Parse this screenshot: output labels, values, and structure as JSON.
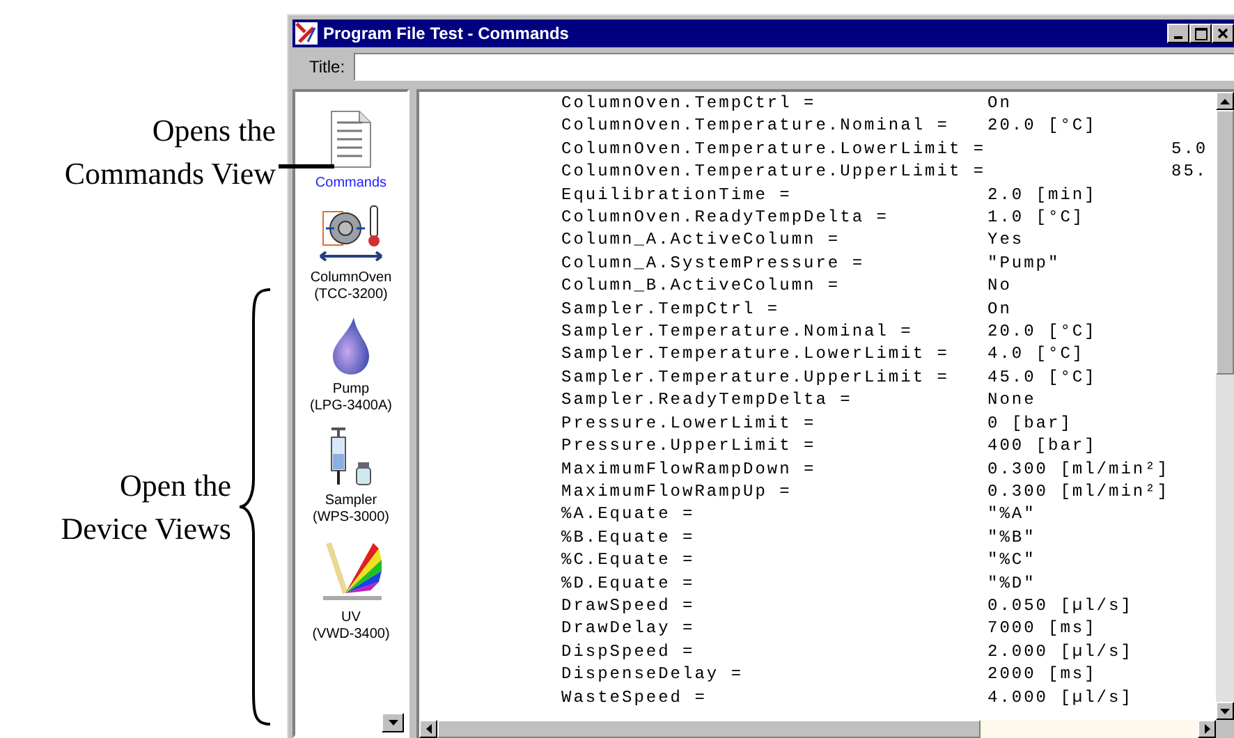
{
  "annotations": [
    {
      "kind": "leader",
      "text": "Opens the Commands View"
    },
    {
      "kind": "brace",
      "text": "Open the Device Views"
    }
  ],
  "window": {
    "title": "Program File Test - Commands"
  },
  "title_field": {
    "label": "Title:"
  },
  "sidebar": {
    "items": [
      {
        "kind": "commands",
        "label": "Commands",
        "selected": true
      },
      {
        "kind": "oven",
        "label": "ColumnOven",
        "sublabel": "(TCC-3200)",
        "selected": false
      },
      {
        "kind": "pump",
        "label": "Pump",
        "sublabel": "(LPG-3400A)",
        "selected": false
      },
      {
        "kind": "sampler",
        "label": "Sampler",
        "sublabel": "(WPS-3000)",
        "selected": false
      },
      {
        "kind": "uv",
        "label": "UV",
        "sublabel": "(VWD-3400)",
        "selected": false
      }
    ]
  },
  "commands": [
    {
      "kind": "near",
      "name": "ColumnOven.TempCtrl =",
      "value": "On"
    },
    {
      "kind": "near",
      "name": "ColumnOven.Temperature.Nominal =",
      "value": "20.0 [°C]"
    },
    {
      "kind": "far",
      "name": "ColumnOven.Temperature.LowerLimit =",
      "value": "5.0"
    },
    {
      "kind": "far",
      "name": "ColumnOven.Temperature.UpperLimit =",
      "value": "85."
    },
    {
      "kind": "near",
      "name": "EquilibrationTime =",
      "value": "2.0 [min]"
    },
    {
      "kind": "near",
      "name": "ColumnOven.ReadyTempDelta =",
      "value": "1.0 [°C]"
    },
    {
      "kind": "near",
      "name": "Column_A.ActiveColumn =",
      "value": "Yes"
    },
    {
      "kind": "near",
      "name": "Column_A.SystemPressure =",
      "value": "\"Pump\""
    },
    {
      "kind": "near",
      "name": "Column_B.ActiveColumn =",
      "value": "No"
    },
    {
      "kind": "near",
      "name": "Sampler.TempCtrl =",
      "value": "On"
    },
    {
      "kind": "near",
      "name": "Sampler.Temperature.Nominal =",
      "value": "20.0 [°C]"
    },
    {
      "kind": "near",
      "name": "Sampler.Temperature.LowerLimit =",
      "value": "4.0 [°C]"
    },
    {
      "kind": "near",
      "name": "Sampler.Temperature.UpperLimit =",
      "value": "45.0 [°C]"
    },
    {
      "kind": "near",
      "name": "Sampler.ReadyTempDelta =",
      "value": "None"
    },
    {
      "kind": "near",
      "name": "Pressure.LowerLimit =",
      "value": "0 [bar]"
    },
    {
      "kind": "near",
      "name": "Pressure.UpperLimit =",
      "value": "400 [bar]"
    },
    {
      "kind": "near",
      "name": "MaximumFlowRampDown =",
      "value": "0.300 [ml/min²]"
    },
    {
      "kind": "near",
      "name": "MaximumFlowRampUp =",
      "value": "0.300 [ml/min²]"
    },
    {
      "kind": "near",
      "name": "%A.Equate =",
      "value": "\"%A\""
    },
    {
      "kind": "near",
      "name": "%B.Equate =",
      "value": "\"%B\""
    },
    {
      "kind": "near",
      "name": "%C.Equate =",
      "value": "\"%C\""
    },
    {
      "kind": "near",
      "name": "%D.Equate =",
      "value": "\"%D\""
    },
    {
      "kind": "near",
      "name": "DrawSpeed =",
      "value": "0.050 [µl/s]"
    },
    {
      "kind": "near",
      "name": "DrawDelay =",
      "value": "7000 [ms]"
    },
    {
      "kind": "near",
      "name": "DispSpeed =",
      "value": "2.000 [µl/s]"
    },
    {
      "kind": "near",
      "name": "DispenseDelay =",
      "value": "2000 [ms]"
    },
    {
      "kind": "near",
      "name": "WasteSpeed =",
      "value": "4.000 [µl/s]"
    }
  ]
}
